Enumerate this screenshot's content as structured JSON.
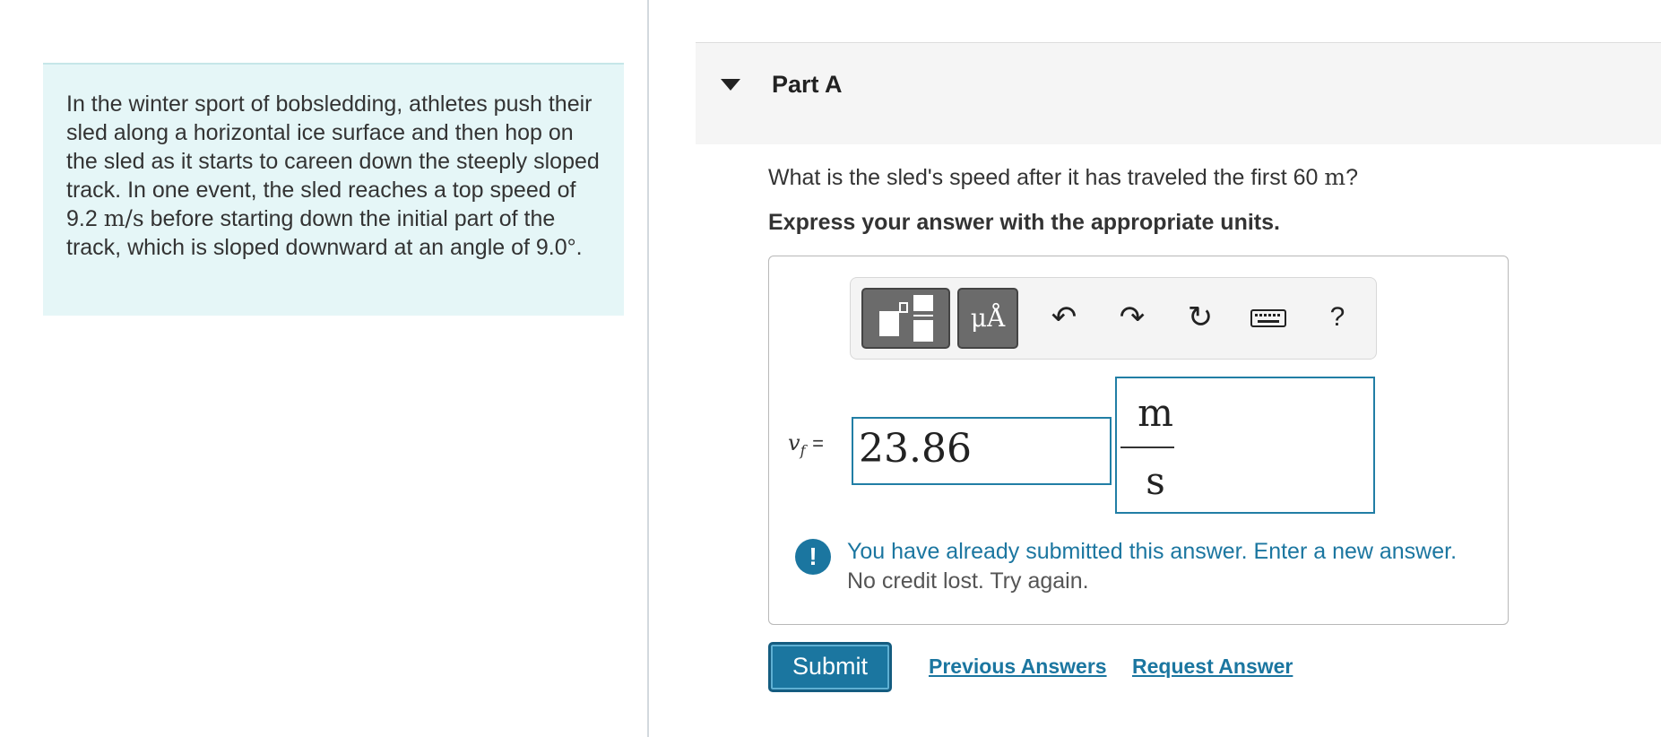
{
  "problem": {
    "text_part1": "In the winter sport of bobsledding, athletes push their sled along a horizontal ice surface and then hop on the sled as it starts to careen down the steeply sloped track. In one event, the sled reaches a top speed of 9.2 ",
    "speed_unit": "m/s",
    "text_part2": " before starting down the initial part of the track, which is sloped downward at an angle of 9.0",
    "angle_unit": "°",
    "text_part3": "."
  },
  "part": {
    "title": "Part A",
    "question_part1": "What is the sled's speed after it has traveled the first 60 ",
    "question_unit": "m",
    "question_part2": "?",
    "instruction": "Express your answer with the appropriate units."
  },
  "toolbar": {
    "mu_label": "μÅ",
    "undo_icon": "↶",
    "redo_icon": "↷",
    "reset_icon": "↻",
    "help_label": "?"
  },
  "answer": {
    "variable": "v",
    "subscript": "f",
    "equals": "=",
    "value": "23.86",
    "unit_numerator": "m",
    "unit_denominator": "s"
  },
  "feedback": {
    "icon": "!",
    "line1": "You have already submitted this answer. Enter a new answer.",
    "line2": "No credit lost. Try again."
  },
  "actions": {
    "submit_label": "Submit",
    "previous_answers_label": "Previous Answers",
    "request_answer_label": "Request Answer"
  }
}
